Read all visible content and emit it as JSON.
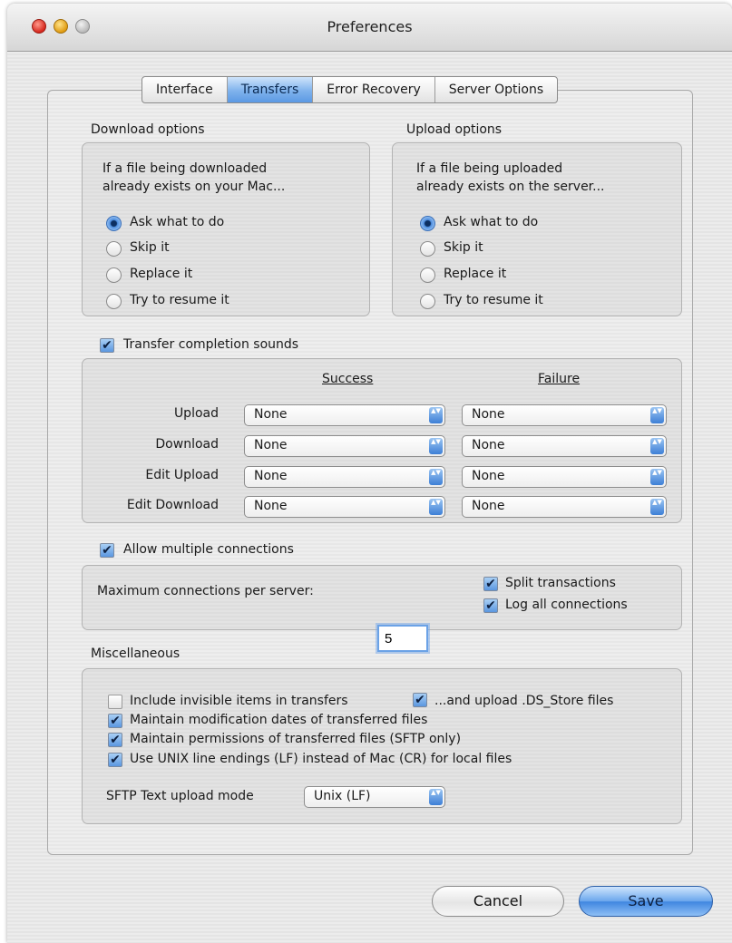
{
  "window": {
    "title": "Preferences"
  },
  "tabs": [
    {
      "label": "Interface",
      "selected": false
    },
    {
      "label": "Transfers",
      "selected": true
    },
    {
      "label": "Error Recovery",
      "selected": false
    },
    {
      "label": "Server Options",
      "selected": false
    }
  ],
  "download": {
    "heading": "Download options",
    "prompt_line1": "If a file being downloaded",
    "prompt_line2": "already exists on your Mac...",
    "options": [
      "Ask what to do",
      "Skip it",
      "Replace it",
      "Try to resume it"
    ],
    "selected": "Ask what to do"
  },
  "upload": {
    "heading": "Upload options",
    "prompt_line1": "If a file being uploaded",
    "prompt_line2": "already exists on the server...",
    "options": [
      "Ask what to do",
      "Skip it",
      "Replace it",
      "Try to resume it"
    ],
    "selected": "Ask what to do"
  },
  "sounds": {
    "checkbox_label": "Transfer completion sounds",
    "checked": true,
    "success_header": "Success",
    "failure_header": "Failure",
    "rows": [
      {
        "label": "Upload",
        "success": "None",
        "failure": "None"
      },
      {
        "label": "Download",
        "success": "None",
        "failure": "None"
      },
      {
        "label": "Edit Upload",
        "success": "None",
        "failure": "None"
      },
      {
        "label": "Edit Download",
        "success": "None",
        "failure": "None"
      }
    ]
  },
  "connections": {
    "checkbox_label": "Allow multiple connections",
    "checked": true,
    "max_label": "Maximum connections per server:",
    "max_value": "5",
    "split_label": "Split transactions",
    "split_checked": true,
    "log_label": "Log all connections",
    "log_checked": true
  },
  "misc": {
    "heading": "Miscellaneous",
    "invisible_label": "Include invisible items in transfers",
    "invisible_checked": false,
    "ds_store_label": "...and upload .DS_Store files",
    "ds_store_checked": true,
    "mod_dates_label": "Maintain modification dates of transferred files",
    "mod_dates_checked": true,
    "permissions_label": "Maintain permissions of transferred files (SFTP only)",
    "permissions_checked": true,
    "unix_label": "Use UNIX line endings (LF) instead of Mac (CR) for local files",
    "unix_checked": true,
    "sftp_mode_label": "SFTP Text upload mode",
    "sftp_mode_value": "Unix (LF)"
  },
  "buttons": {
    "cancel": "Cancel",
    "save": "Save"
  },
  "icons": {
    "checkmark": "✔",
    "popup_arrows": "▲▼"
  }
}
